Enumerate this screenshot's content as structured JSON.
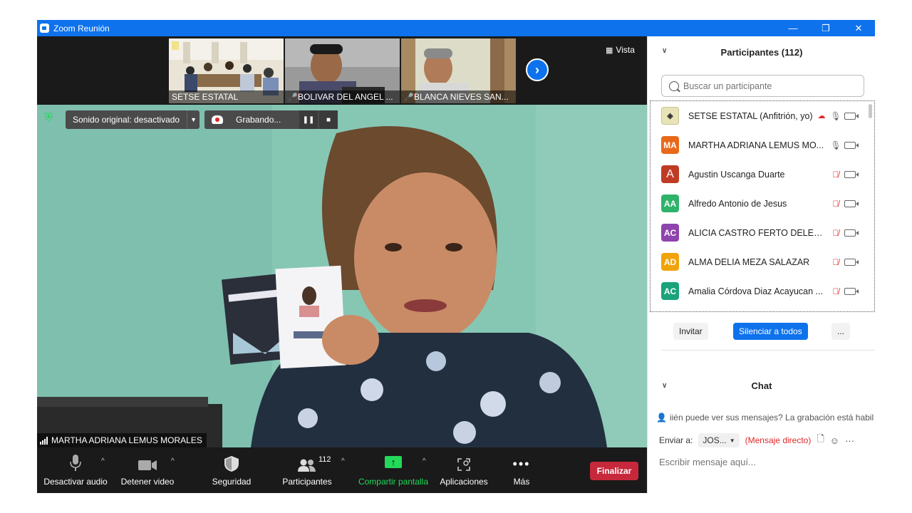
{
  "window": {
    "title": "Zoom Reunión",
    "minimize": "—",
    "restore": "❐",
    "close": "✕"
  },
  "gallery": {
    "thumbnails": [
      {
        "name": "SETSE ESTATAL",
        "muted": false
      },
      {
        "name": "BOLIVAR DEL ANGEL ...",
        "muted": true
      },
      {
        "name": "BLANCA NIEVES  SAN...",
        "muted": true
      }
    ],
    "view_label": "Vista"
  },
  "meeting": {
    "sound_label": "Sonido original: desactivado",
    "recording_label": "Grabando...",
    "speaker_name": "MARTHA ADRIANA LEMUS MORALES"
  },
  "toolbar": {
    "audio": "Desactivar audio",
    "video": "Detener video",
    "security": "Seguridad",
    "participants": "Participantes",
    "participants_count": "112",
    "share": "Compartir pantalla",
    "apps": "Aplicaciones",
    "more": "Más",
    "end": "Finalizar"
  },
  "participants_panel": {
    "title": "Participantes (112)",
    "search_placeholder": "Buscar un participante",
    "items": [
      {
        "initials": "",
        "name": "SETSE ESTATAL (Anfitrión, yo)",
        "color": "#e9e4b8",
        "muted": false,
        "recording": true
      },
      {
        "initials": "MA",
        "name": "MARTHA ADRIANA LEMUS MO...",
        "color": "#e8681a",
        "muted": false,
        "recording": false
      },
      {
        "initials": "A",
        "name": "Agustin Uscanga Duarte",
        "color": "#c03b24",
        "muted": true,
        "recording": false
      },
      {
        "initials": "AA",
        "name": "Alfredo Antonio de Jesus",
        "color": "#2fb36b",
        "muted": true,
        "recording": false
      },
      {
        "initials": "AC",
        "name": "ALICIA CASTRO FERTO DELEGAC...",
        "color": "#8e44ad",
        "muted": true,
        "recording": false
      },
      {
        "initials": "AD",
        "name": "ALMA DELIA MEZA SALAZAR",
        "color": "#f0a30a",
        "muted": true,
        "recording": false
      },
      {
        "initials": "AC",
        "name": "Amalia Córdova Diaz Acayucan ...",
        "color": "#1aa37a",
        "muted": true,
        "recording": false
      }
    ],
    "invite": "Invitar",
    "mute_all": "Silenciar a todos",
    "more": "..."
  },
  "chat": {
    "title": "Chat",
    "info": "iién puede ver sus mensajes? La grabación está habilit",
    "send_to_label": "Enviar a:",
    "recipient": "JOS...",
    "direct": "(Mensaje directo)",
    "input_placeholder": "Escribir mensaje aquí...",
    "more": "···"
  },
  "colors": {
    "zoom_blue": "#0e72ed",
    "end_red": "#c7283b",
    "share_green": "#23d959"
  }
}
